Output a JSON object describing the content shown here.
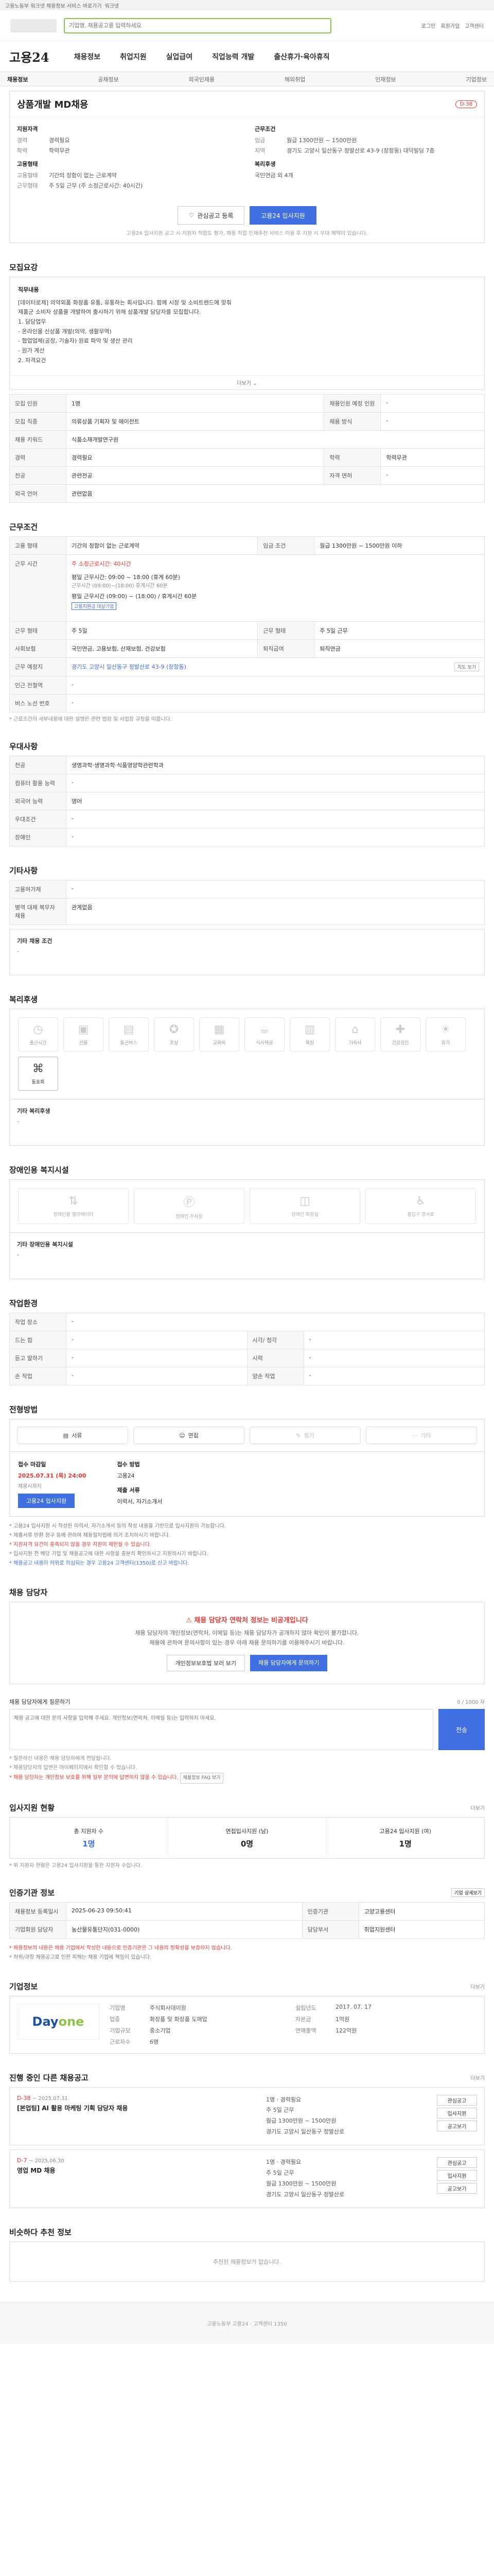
{
  "topbar": {
    "text": "고용노동부 워크넷 채용정보 서비스 바로가기",
    "link": "워크넷"
  },
  "header": {
    "search_placeholder": "기업명, 채용공고를 입력하세요",
    "links": [
      "로그인",
      "회원가입",
      "고객센터"
    ]
  },
  "brand": {
    "name": "고용24"
  },
  "gnb": [
    "채용정보",
    "취업지원",
    "실업급여",
    "직업능력 개발",
    "출산휴가·육아휴직"
  ],
  "subnav": {
    "items": [
      "채용정보",
      "공채정보",
      "외국인채용",
      "해외취업",
      "인재정보",
      "기업정보"
    ],
    "active": 0
  },
  "job": {
    "title": "상품개발 MD채용",
    "dday": "D-38",
    "requirements_title": "지원자격",
    "requirements": [
      {
        "k": "경력",
        "v": "경력필요"
      },
      {
        "k": "학력",
        "v": "학력무관"
      }
    ],
    "conditions_title": "근무조건",
    "conditions": [
      {
        "k": "임금",
        "v": "월급 1300만원 ~ 1500만원"
      },
      {
        "k": "지역",
        "v": "경기도 고양시 일산동구 정발산로 43-9 (장항동) 대덕빌딩 7층"
      }
    ],
    "employment_title": "고용형태",
    "employment": [
      {
        "k": "고용형태",
        "v": "기간의 정함이 없는 근로계약"
      },
      {
        "k": "근무형태",
        "v": "주 5일 근무 (주 소정근로시간: 40시간)"
      }
    ],
    "welfare_title": "복리후생",
    "welfare": "국민연금 외 4개",
    "interest_button": "관심공고 등록",
    "apply_button": "고용24 입사지원",
    "notice": "고용24 입사지원 공고 시 지원자 적합도 평가, 채용 적합 인재추천 서비스 이용 후 지원 시 우대 혜택이 있습니다."
  },
  "s_recruit": {
    "title": "모집요강",
    "desc_heading": "직무내용",
    "desc": [
      "[데이터로제] 의약외품 화장품 유통, 유통하는 회사입니다. 함께 시장 및 소비트렌드에 맞춰",
      "제품군 소비자 상품을 개발하여 출시하기 위해 상품개발 담당자를 모집합니다.",
      "",
      "1. 담당업무",
      " - 온라인몰 신상품 개발(의약, 생활무역)",
      " - 협업업체(공장, 기술자) 원료 파악 및 생산 관리",
      " - 원가 계산",
      "",
      "2. 자격요건"
    ],
    "toggle": "더보기",
    "rows": [
      {
        "k1": "모집 인원",
        "v1": "1명",
        "k2": "채용인원 예정 인원",
        "v2": "-"
      },
      {
        "k1": "모집 직종",
        "v1": "의류상품 기획자 및 에이전트",
        "k2": "채용 방식",
        "v2": "-"
      },
      {
        "k1": "채용 키워드",
        "v1": "식품소재개발연구원",
        "k2": "",
        "v2": ""
      },
      {
        "k1": "경력",
        "v1": "경력필요",
        "k2": "학력",
        "v2": "학력무관"
      },
      {
        "k1": "전공",
        "v1": "관련전공",
        "k2": "자격 면허",
        "v2": "-"
      },
      {
        "k1": "외국 언어",
        "v1": "관련없음",
        "k2": "",
        "v2": ""
      }
    ]
  },
  "s_cond": {
    "title": "근무조건",
    "rows": [
      {
        "k": "고용 형태",
        "v": "기간의 정함이 없는 근로계약",
        "k2": "임금 조건",
        "v2": "월급 1300만원 ~ 1500만원 이하"
      },
      {
        "k": "근무 시간",
        "v": "주 소정근로시간: 40시간",
        "k2": "",
        "v2": ""
      },
      {
        "k": "",
        "v": "평일 근무시간 (09:00) ~ (18:00) / 휴게시간 60분",
        "k2": "",
        "v2": ""
      },
      {
        "k": "근무 형태",
        "v": "주 5일",
        "k2": "근무 형태",
        "v2": "주 5일 근무"
      },
      {
        "k": "사회보험",
        "v": "국민연금, 고용보험, 산재보험, 건강보험",
        "k2": "퇴직급여",
        "v2": "퇴직연금"
      },
      {
        "k": "근무 예정지",
        "v": "경기도 고양시 일산동구 정발산로 43-9 (장항동)",
        "k2": "",
        "v2": ""
      },
      {
        "k": "인근 전철역",
        "v": "-",
        "k2": "",
        "v2": ""
      },
      {
        "k": "버스 노선 번호",
        "v": "-",
        "k2": "",
        "v2": ""
      }
    ],
    "time_detail": "평일 근무시간: 09:00 ~ 18:00 (휴게 60분)",
    "time_note": "근무시간 (09:00)~(18:00) 휴게시간 60분",
    "tag": "고용지원금 대상기업",
    "map_button": "지도 보기",
    "footnote": "* 근로조건의 세부내용에 대한 설명은 관련 법령 및 사업장 규정을 따릅니다."
  },
  "s_pref": {
    "title": "우대사항",
    "rows": [
      {
        "k": "전공",
        "v": "생명과학·생명과학·식품영양학관련학과"
      },
      {
        "k": "컴퓨터 활용 능력",
        "v": "-"
      },
      {
        "k": "외국어 능력",
        "v": "영어"
      },
      {
        "k": "우대조건",
        "v": "-"
      },
      {
        "k": "장애인",
        "v": "-"
      }
    ]
  },
  "s_etc": {
    "title": "기타사항",
    "rows": [
      {
        "k": "고용허가제",
        "v": "-"
      },
      {
        "k": "병역 대체 복무자 채용",
        "v": "관계없음"
      }
    ],
    "extra_label": "기타 채용 조건",
    "extra_value": "-"
  },
  "s_welfare": {
    "title": "복리후생",
    "tiles": [
      {
        "icon": "clock-icon",
        "label": "출근시간",
        "on": false
      },
      {
        "icon": "gift-icon",
        "label": "선물",
        "on": false
      },
      {
        "icon": "bus-icon",
        "label": "통근버스",
        "on": false
      },
      {
        "icon": "award-icon",
        "label": "포상",
        "on": false
      },
      {
        "icon": "education-icon",
        "label": "교육비",
        "on": false
      },
      {
        "icon": "cafe-icon",
        "label": "식사제공",
        "on": false
      },
      {
        "icon": "shirt-icon",
        "label": "복장",
        "on": false
      },
      {
        "icon": "house-icon",
        "label": "기숙사",
        "on": false
      },
      {
        "icon": "health-icon",
        "label": "건강검진",
        "on": false
      },
      {
        "icon": "vacation-icon",
        "label": "휴가",
        "on": false
      },
      {
        "icon": "paw-icon",
        "label": "동호회",
        "on": true
      }
    ],
    "sub_label": "기타 복리후생",
    "sub_value": "-"
  },
  "s_disability": {
    "title": "장애인용 복지시설",
    "tiles": [
      {
        "icon": "ramp-icon",
        "label": "장애인용 엘리베이터"
      },
      {
        "icon": "parking-icon",
        "label": "장애인 주차장"
      },
      {
        "icon": "toilet-icon",
        "label": "장애인 화장실"
      },
      {
        "icon": "accessible-icon",
        "label": "출입구 경사로"
      }
    ],
    "sub_label": "기타 장애인용 복지시설",
    "sub_value": "-"
  },
  "s_environment": {
    "title": "작업환경",
    "rows": [
      {
        "k": "작업 장소",
        "v": "-",
        "k2": "",
        "v2": ""
      },
      {
        "k": "드는 힘",
        "v": "-",
        "k2": "시각/ 청각",
        "v2": "-"
      },
      {
        "k": "듣고 말하기",
        "v": "-",
        "k2": "시력",
        "v2": "-"
      },
      {
        "k": "손 작업",
        "v": "-",
        "k2": "양손 작업",
        "v2": "-"
      }
    ]
  },
  "s_apply": {
    "title": "전형방법",
    "methods": [
      {
        "icon": "document-icon",
        "label": "서류",
        "on": true
      },
      {
        "icon": "interview-icon",
        "label": "면접",
        "on": true
      },
      {
        "icon": "pencil-icon",
        "label": "필기",
        "on": false
      },
      {
        "icon": "etc-icon",
        "label": "기타",
        "on": false
      }
    ],
    "period_title": "접수 마감일",
    "period_value": "2025.07.31 (목) 24:00",
    "period_sub": "채용시까지",
    "apply_button": "고용24 입사지원",
    "method_title": "접수 방법",
    "method_value": "고용24",
    "docs_title": "제출 서류",
    "docs_value": "이력서, 자기소개서",
    "notes": [
      "* 고용24 입사지원 시 작성된 이력서, 자기소개서 등의 작성 내용을 기반으로 입사지원이 가능합니다.",
      "* 제출서류 반환 청구 등에 관하여 채용절차법에 의거 조치하시기 바랍니다.",
      "* 지원자격 요건이 충족되지 않을 경우 지원이 제한될 수 있습니다.",
      "* 입사지원 전 해당 기업 및 채용공고에 대한 사항을 충분히 확인하시고 지원하시기 바랍니다.",
      "* 채용공고 내용이 허위로 의심되는 경우 고용24 고객센터(1350)로 신고 바랍니다."
    ]
  },
  "s_contact": {
    "title": "채용 담당자",
    "alert": "채용 담당자 연락처 정보는 비공개입니다",
    "sub1": "채용 담당자의 개인정보(연락처, 이메일 등)는 채용 담당자가 공개하지 않아 확인이 불가합니다.",
    "sub2": "채용에 관하여 문의사항이 있는 경우 아래 채용 문의하기를 이용해주시기 바랍니다.",
    "btn1": "개인정보보호법 보러 보기",
    "btn2": "채용 담당자에게 문의하기"
  },
  "s_qna": {
    "head": "채용 담당자에게 질문하기",
    "head_right": "0 / 1000 자",
    "placeholder": "채용 공고에 대한 문의 사항을 입력해 주세요. 개인정보(연락처, 이메일 등)는 입력하지 마세요.",
    "submit": "전송",
    "notes": [
      "* 질문하신 내용은 채용 담당자에게 전달됩니다.",
      "* 채용담당자의 답변은 마이페이지에서 확인할 수 있습니다.",
      "* 채용 담당자는 개인정보 보호를 위해 일부 문의에 답변하지 않을 수 있습니다."
    ],
    "notes_link": "채용정보 FAQ 보기"
  },
  "s_stats": {
    "title": "입사지원 현황",
    "more": "더보기",
    "items": [
      {
        "label": "총 지원자 수",
        "value": "1명",
        "blue": true
      },
      {
        "label": "면접입사지원 (남)",
        "value": "0명",
        "blue": false
      },
      {
        "label": "고용24 입사지원 (여)",
        "value": "1명",
        "blue": false
      }
    ],
    "note": "* 위 지원자 현황은 고용24 입사지원을 통한 지원자 수입니다."
  },
  "s_agency": {
    "title": "인증기관 정보",
    "more": "기업 상세보기",
    "rows": [
      {
        "k": "채용정보 등록일시",
        "v": "2025-06-23 09:50:41",
        "k2": "인증기관",
        "v2": "고양고용센터"
      },
      {
        "k": "기업회원 담당자",
        "v": "농산물유통단지(031-0000)",
        "k2": "담당부서",
        "v2": "취업지원센터"
      }
    ],
    "notes": [
      "* 채용정보의 내용은 채용 기업에서 작성한 내용으로 인증기관은 그 내용의 정확성을 보증하지 않습니다.",
      "* 허위/과장 채용공고로 인한 피해는 채용 기업에 책임이 있습니다."
    ]
  },
  "s_company": {
    "title": "기업정보",
    "more": "더보기",
    "logo_main": "Day",
    "logo_accent": "one",
    "info": [
      {
        "k": "기업명",
        "v": "주식회사데이원"
      },
      {
        "k": "업종",
        "v": "화장품 및 화장품 도매업"
      },
      {
        "k": "기업규모",
        "v": "중소기업"
      },
      {
        "k": "근로자수",
        "v": "6명"
      },
      {
        "k": "설립년도",
        "v": "2017. 07. 17"
      },
      {
        "k": "자본금",
        "v": "1억원"
      },
      {
        "k": "연매출액",
        "v": "122억원"
      }
    ]
  },
  "s_related": {
    "title": "진행 중인 다른 채용공고",
    "more": "더보기",
    "items": [
      {
        "dday": "D-38",
        "date": "~ 2025.07.31",
        "title": "[본업팀] AI 활용 마케팅 기획 담당자 채용",
        "meta": [
          "1명",
          "경력필요",
          "주 5일 근무",
          "월급 1300만원 ~ 1500만원",
          "경기도 고양시 일산동구 정발산로"
        ],
        "btns": [
          "관심공고",
          "입사지원",
          "공고보기"
        ]
      },
      {
        "dday": "D-7",
        "date": "~ 2025.06.30",
        "title": "영업 MD 채용",
        "meta": [
          "1명",
          "경력필요",
          "주 5일 근무",
          "월급 1300만원 ~ 1500만원",
          "경기도 고양시 일산동구 정발산로"
        ],
        "btns": [
          "관심공고",
          "입사지원",
          "공고보기"
        ]
      }
    ]
  },
  "s_similar": {
    "title": "비슷하다 추천 정보",
    "empty": "추천된 채용정보가 없습니다."
  },
  "footer": {
    "text": "고용노동부 고용24 · 고객센터 1350"
  }
}
